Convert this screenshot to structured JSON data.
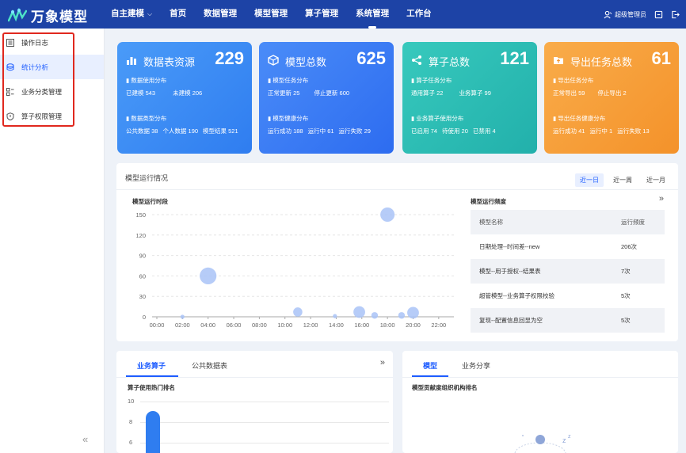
{
  "app": {
    "name": "万象模型"
  },
  "nav": {
    "items": [
      {
        "label": "自主建模",
        "caret": "⌵"
      },
      {
        "label": "首页"
      },
      {
        "label": "数据管理"
      },
      {
        "label": "模型管理"
      },
      {
        "label": "算子管理"
      },
      {
        "label": "系统管理",
        "active": true
      },
      {
        "label": "工作台"
      }
    ]
  },
  "user": {
    "name": "超级管理员"
  },
  "sidebar": {
    "items": [
      {
        "label": "操作日志",
        "icon": "list-icon"
      },
      {
        "label": "统计分析",
        "icon": "database-icon",
        "active": true
      },
      {
        "label": "业务分类管理",
        "icon": "category-icon"
      },
      {
        "label": "算子权限管理",
        "icon": "shield-icon"
      }
    ],
    "collapse": "«"
  },
  "cards": [
    {
      "title": "数据表资源",
      "value": "229",
      "color": "#3d8ef5",
      "sec1": "数据使用分布",
      "row1": [
        "已建模 543",
        "未建模 206"
      ],
      "sec2": "数据类型分布",
      "row2": [
        "公共数据 38",
        "个人数据 190",
        "模型结果 521"
      ]
    },
    {
      "title": "模型总数",
      "value": "625",
      "color": "#3f78f2",
      "sec1": "模型任务分布",
      "row1": [
        "正常更新 25",
        "停止更新 600"
      ],
      "sec2": "模型健康分布",
      "row2": [
        "运行成功 188",
        "运行中 61",
        "运行失败 29"
      ]
    },
    {
      "title": "算子总数",
      "value": "121",
      "color": "#2dbdb3",
      "sec1": "算子任务分布",
      "row1": [
        "通用算子 22",
        "业务算子 99"
      ],
      "sec2": "业务算子使用分布",
      "row2": [
        "已启用 74",
        "待使用 20",
        "已禁用 4"
      ]
    },
    {
      "title": "导出任务总数",
      "value": "61",
      "color": "#f7a23d",
      "sec1": "导出任务分布",
      "row1": [
        "正常导出 59",
        "停止导出 2"
      ],
      "sec2": "导出任务健康分布",
      "row2": [
        "运行成功 41",
        "运行中 1",
        "运行失败 13"
      ]
    }
  ],
  "run_panel": {
    "title": "模型运行情况",
    "ranges": [
      "近一日",
      "近一周",
      "近一月"
    ],
    "chart_title": "模型运行时段",
    "table_title": "模型运行频度",
    "table_header": [
      "模型名称",
      "运行频度"
    ],
    "table_rows": [
      [
        "日期处理--时间差--new",
        "206次"
      ],
      [
        "模型--用于授权--结果表",
        "7次"
      ],
      [
        "超管模型--业务算子权限校验",
        "5次"
      ],
      [
        "复现--配置信息回显为空",
        "5次"
      ]
    ],
    "expand": "»"
  },
  "chart_data": {
    "type": "scatter",
    "title": "模型运行时段",
    "x_ticks": [
      "00:00",
      "02:00",
      "04:00",
      "06:00",
      "08:00",
      "10:00",
      "12:00",
      "14:00",
      "16:00",
      "18:00",
      "20:00",
      "22:00"
    ],
    "y_ticks": [
      "0",
      "30",
      "60",
      "90",
      "120",
      "150"
    ],
    "ylim": [
      0,
      150
    ],
    "xlim_hours": [
      0,
      23
    ],
    "points": [
      {
        "x": 2.0,
        "y": 0,
        "r": 1
      },
      {
        "x": 4.0,
        "y": 60,
        "r": 6
      },
      {
        "x": 11.0,
        "y": 7,
        "r": 3
      },
      {
        "x": 13.9,
        "y": 1,
        "r": 1
      },
      {
        "x": 15.8,
        "y": 7,
        "r": 4
      },
      {
        "x": 17.0,
        "y": 2,
        "r": 2
      },
      {
        "x": 18.0,
        "y": 150,
        "r": 5
      },
      {
        "x": 19.1,
        "y": 2,
        "r": 2
      },
      {
        "x": 20.0,
        "y": 6,
        "r": 4
      }
    ],
    "color": "#a9c3f7"
  },
  "bottom_left": {
    "tabs": [
      "业务算子",
      "公共数据表"
    ],
    "expand": "»",
    "subtitle": "算子使用热门排名",
    "y_ticks": [
      "10",
      "8",
      "6"
    ]
  },
  "bottom_right": {
    "tabs": [
      "模型",
      "业务分享"
    ],
    "subtitle": "模型贡献度组织机构排名"
  }
}
